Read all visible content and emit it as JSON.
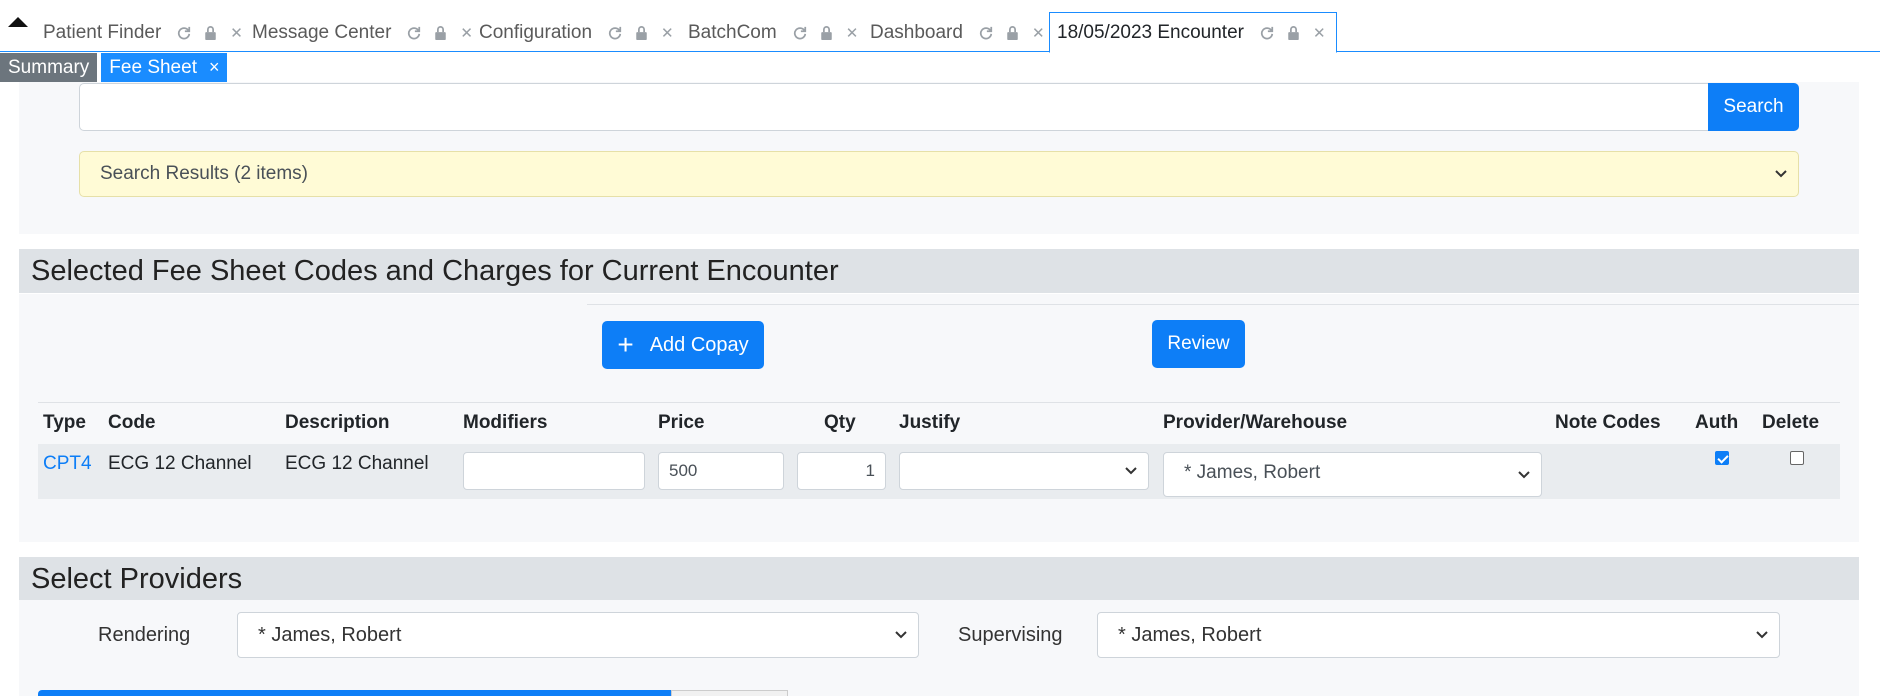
{
  "tabs": [
    {
      "label": "Patient Finder",
      "active": false
    },
    {
      "label": "Message Center",
      "active": false
    },
    {
      "label": "Configuration",
      "active": false
    },
    {
      "label": "BatchCom",
      "active": false
    },
    {
      "label": "Dashboard",
      "active": false
    },
    {
      "label": "18/05/2023 Encounter",
      "active": true
    }
  ],
  "subtabs": {
    "summary": "Summary",
    "fee_sheet": "Fee Sheet",
    "close": "×"
  },
  "search": {
    "value": "",
    "button": "Search",
    "results": "Search Results (2 items)"
  },
  "fees": {
    "title": "Selected Fee Sheet Codes and Charges for Current Encounter",
    "add_copay": "Add Copay",
    "review": "Review",
    "columns": [
      "Type",
      "Code",
      "Description",
      "Modifiers",
      "Price",
      "Qty",
      "Justify",
      "Provider/Warehouse",
      "Note Codes",
      "Auth",
      "Delete"
    ],
    "row": {
      "type": "CPT4",
      "code": "ECG 12 Channel",
      "description": "ECG 12 Channel",
      "modifiers": "",
      "price": "500",
      "qty": "1",
      "justify": "",
      "provider": "* James, Robert",
      "auth": true,
      "delete": false
    }
  },
  "providers": {
    "title": "Select Providers",
    "rendering_label": "Rendering",
    "rendering_value": "* James, Robert",
    "supervising_label": "Supervising",
    "supervising_value": "* James, Robert"
  },
  "colors": {
    "primary": "#0d7ef7",
    "results_bg": "#fffbd6",
    "section_bg": "#dee2e6",
    "panel_bg": "#f7f8fa"
  }
}
